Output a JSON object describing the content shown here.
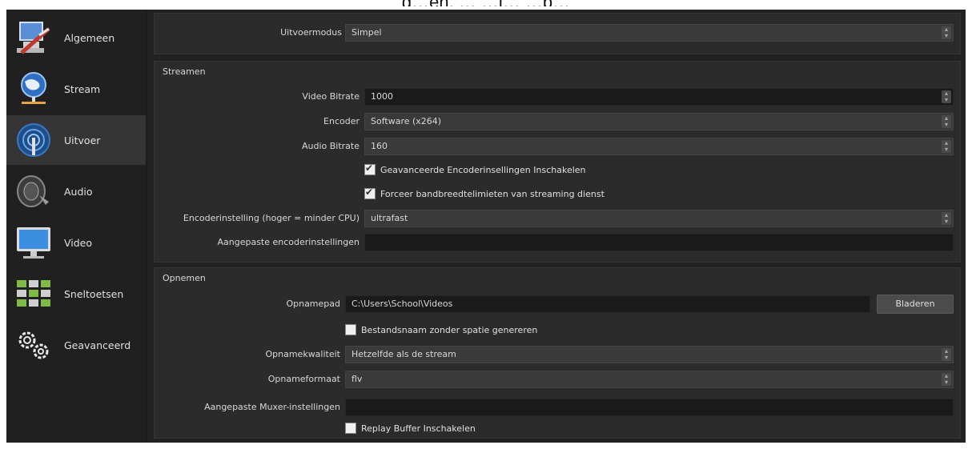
{
  "overlay": {
    "caption_fragment": "g…en, … …j… …p…"
  },
  "sidebar": {
    "items": [
      {
        "label": "Algemeen",
        "icon": "general-settings-icon"
      },
      {
        "label": "Stream",
        "icon": "stream-globe-icon"
      },
      {
        "label": "Uitvoer",
        "icon": "output-broadcast-icon",
        "active": true
      },
      {
        "label": "Audio",
        "icon": "speaker-icon"
      },
      {
        "label": "Video",
        "icon": "monitor-icon"
      },
      {
        "label": "Sneltoetsen",
        "icon": "keyboard-icon"
      },
      {
        "label": "Geavanceerd",
        "icon": "gears-icon"
      }
    ]
  },
  "output_mode": {
    "label": "Uitvoermodus",
    "value": "Simpel"
  },
  "streaming": {
    "title": "Streamen",
    "video_bitrate": {
      "label": "Video Bitrate",
      "value": "1000"
    },
    "encoder": {
      "label": "Encoder",
      "value": "Software (x264)"
    },
    "audio_bitrate": {
      "label": "Audio Bitrate",
      "value": "160"
    },
    "advanced_encoder": {
      "label": "Geavanceerde Encoderinsellingen Inschakelen",
      "checked": true
    },
    "bandwidth_limits": {
      "label": "Forceer bandbreedtelimieten van streaming dienst",
      "checked": true
    },
    "encoder_preset": {
      "label": "Encoderinstelling (hoger = minder CPU)",
      "value": "ultrafast"
    },
    "custom_encoder": {
      "label": "Aangepaste encoderinstellingen",
      "value": ""
    }
  },
  "recording": {
    "title": "Opnemen",
    "path": {
      "label": "Opnamepad",
      "value": "C:\\Users\\School\\Videos"
    },
    "browse_label": "Bladeren",
    "no_space": {
      "label": "Bestandsnaam zonder spatie genereren",
      "checked": false
    },
    "quality": {
      "label": "Opnamekwaliteit",
      "value": "Hetzelfde als de stream"
    },
    "format": {
      "label": "Opnameformaat",
      "value": "flv"
    },
    "muxer": {
      "label": "Aangepaste Muxer-instellingen",
      "value": ""
    },
    "replay_buffer": {
      "label": "Replay Buffer Inschakelen",
      "checked": false
    }
  }
}
